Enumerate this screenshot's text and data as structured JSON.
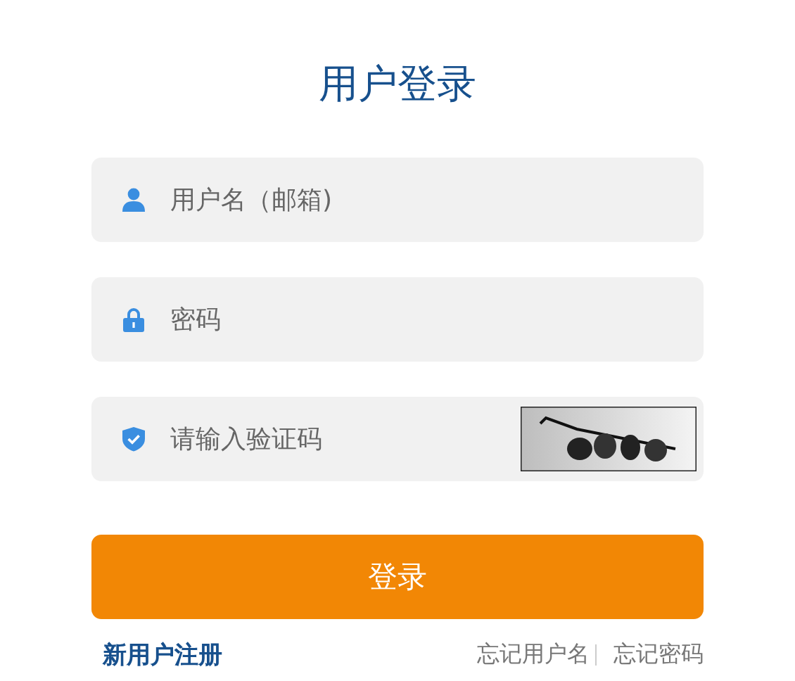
{
  "title": "用户登录",
  "fields": [
    {
      "kind": "user",
      "placeholder": "用户名（邮箱)",
      "captcha": false
    },
    {
      "kind": "lock",
      "placeholder": "密码",
      "captcha": false
    },
    {
      "kind": "shield",
      "placeholder": "请输入验证码",
      "captcha": true
    }
  ],
  "submit": "登录",
  "register_link": "新用户注册",
  "help_links": [
    "忘记用户名",
    "忘记密码"
  ]
}
